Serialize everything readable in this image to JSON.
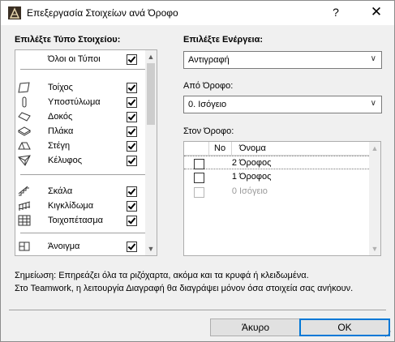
{
  "window": {
    "title": "Επεξεργασία Στοιχείων ανά Όροφο",
    "help_label": "?",
    "close_label": "✕"
  },
  "left": {
    "heading": "Επιλέξτε Τύπο Στοιχείου:",
    "all_types": {
      "label": "Όλοι οι Τύποι",
      "checked": true
    },
    "types": [
      {
        "label": "Τοίχος",
        "icon": "wall-icon",
        "checked": true
      },
      {
        "label": "Υποστύλωμα",
        "icon": "column-icon",
        "checked": true
      },
      {
        "label": "Δοκός",
        "icon": "beam-icon",
        "checked": true
      },
      {
        "label": "Πλάκα",
        "icon": "slab-icon",
        "checked": true
      },
      {
        "label": "Στέγη",
        "icon": "roof-icon",
        "checked": true
      },
      {
        "label": "Κέλυφος",
        "icon": "shell-icon",
        "checked": true
      },
      {
        "label": "Σκάλα",
        "icon": "stair-icon",
        "checked": true
      },
      {
        "label": "Κιγκλίδωμα",
        "icon": "railing-icon",
        "checked": true
      },
      {
        "label": "Τοιχοπέτασμα",
        "icon": "curtain-wall-icon",
        "checked": true
      },
      {
        "label": "Άνοιγμα",
        "icon": "opening-icon",
        "checked": true
      }
    ]
  },
  "right": {
    "action_heading": "Επιλέξτε Ενέργεια:",
    "action_value": "Αντιγραφή",
    "from_heading": "Από Όροφο:",
    "from_value": "0. Ισόγειο",
    "to_heading": "Στον Όροφο:",
    "columns": {
      "no": "No",
      "name": "Όνομα"
    },
    "floors": [
      {
        "no": "2",
        "name": "Όροφος",
        "checked": false,
        "selected": true,
        "disabled": false
      },
      {
        "no": "1",
        "name": "Όροφος",
        "checked": false,
        "selected": false,
        "disabled": false
      },
      {
        "no": "0",
        "name": "Ισόγειο",
        "checked": false,
        "selected": false,
        "disabled": true
      }
    ]
  },
  "notes": {
    "line1": "Σημείωση: Επηρεάζει όλα τα ριζόχαρτα, ακόμα και τα κρυφά ή κλειδωμένα.",
    "line2": "Στο Teamwork, η λειτουργία Διαγραφή θα διαγράψει μόνον όσα στοιχεία σας ανήκουν."
  },
  "buttons": {
    "cancel": "Άκυρο",
    "ok": "OK"
  }
}
